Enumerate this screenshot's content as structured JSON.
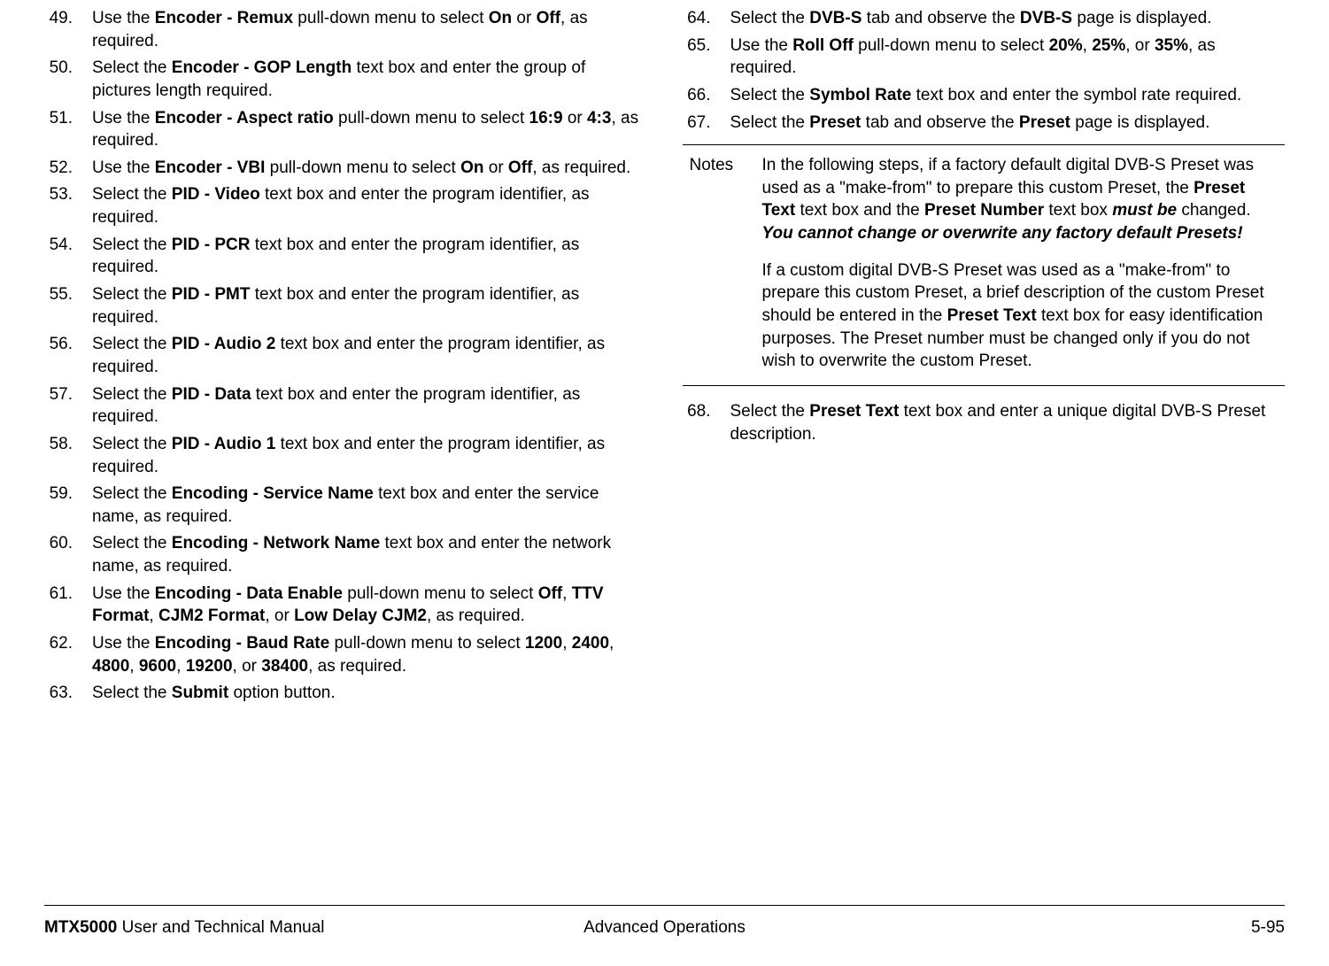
{
  "leftColumn": {
    "steps": [
      {
        "num": "49.",
        "parts": [
          "Use the ",
          {
            "b": "Encoder - Remux"
          },
          " pull-down menu to select ",
          {
            "b": "On"
          },
          " or ",
          {
            "b": "Off"
          },
          ", as required."
        ]
      },
      {
        "num": "50.",
        "parts": [
          "Select the ",
          {
            "b": "Encoder - GOP Length"
          },
          " text box and enter the group of pictures length required."
        ]
      },
      {
        "num": "51.",
        "parts": [
          "Use the ",
          {
            "b": "Encoder - Aspect ratio"
          },
          " pull-down menu to select ",
          {
            "b": "16:9"
          },
          " or ",
          {
            "b": "4:3"
          },
          ", as required."
        ]
      },
      {
        "num": "52.",
        "parts": [
          "Use the ",
          {
            "b": "Encoder - VBI"
          },
          " pull-down menu to select ",
          {
            "b": "On"
          },
          " or ",
          {
            "b": "Off"
          },
          ", as required."
        ]
      },
      {
        "num": "53.",
        "parts": [
          "Select the ",
          {
            "b": "PID - Video"
          },
          " text box and enter the program identifier, as required."
        ]
      },
      {
        "num": "54.",
        "parts": [
          "Select the ",
          {
            "b": "PID - PCR"
          },
          " text box and enter the program identifier, as required."
        ]
      },
      {
        "num": "55.",
        "parts": [
          "Select the ",
          {
            "b": "PID - PMT"
          },
          " text box and enter the program identifier, as required."
        ]
      },
      {
        "num": "56.",
        "parts": [
          "Select the ",
          {
            "b": "PID - Audio 2"
          },
          " text box and enter the program identifier, as required."
        ]
      },
      {
        "num": "57.",
        "parts": [
          "Select the ",
          {
            "b": "PID - Data"
          },
          " text box and enter the program identifier, as required."
        ]
      },
      {
        "num": "58.",
        "parts": [
          "Select the ",
          {
            "b": "PID - Audio 1"
          },
          " text box and enter the program identifier, as required."
        ]
      },
      {
        "num": "59.",
        "parts": [
          "Select the ",
          {
            "b": "Encoding - Service Name"
          },
          " text box and enter the service name, as required."
        ]
      },
      {
        "num": "60.",
        "parts": [
          "Select the ",
          {
            "b": "Encoding - Network Name"
          },
          " text box and enter the network name, as required."
        ]
      },
      {
        "num": "61.",
        "parts": [
          "Use the ",
          {
            "b": "Encoding - Data Enable"
          },
          " pull-down menu to select ",
          {
            "b": "Off"
          },
          ", ",
          {
            "b": "TTV Format"
          },
          ", ",
          {
            "b": "CJM2 Format"
          },
          ", or ",
          {
            "b": "Low Delay CJM2"
          },
          ", as required."
        ]
      },
      {
        "num": "62.",
        "parts": [
          "Use the ",
          {
            "b": "Encoding - Baud Rate"
          },
          " pull-down menu to select ",
          {
            "b": "1200"
          },
          ", ",
          {
            "b": "2400"
          },
          ", ",
          {
            "b": "4800"
          },
          ", ",
          {
            "b": "9600"
          },
          ", ",
          {
            "b": "19200"
          },
          ", or ",
          {
            "b": "38400"
          },
          ", as required."
        ]
      },
      {
        "num": "63.",
        "parts": [
          "Select the ",
          {
            "b": "Submit"
          },
          " option button."
        ]
      }
    ]
  },
  "rightColumn": {
    "stepsTop": [
      {
        "num": "64.",
        "parts": [
          "Select the ",
          {
            "b": "DVB-S"
          },
          " tab and observe the ",
          {
            "b": "DVB-S"
          },
          " page is displayed."
        ]
      },
      {
        "num": "65.",
        "parts": [
          "Use the ",
          {
            "b": "Roll Off"
          },
          " pull-down menu to select ",
          {
            "b": "20%"
          },
          ", ",
          {
            "b": "25%"
          },
          ", or ",
          {
            "b": "35%"
          },
          ", as required."
        ]
      },
      {
        "num": "66.",
        "parts": [
          "Select the ",
          {
            "b": "Symbol Rate"
          },
          " text box and enter the symbol rate required."
        ]
      },
      {
        "num": "67.",
        "parts": [
          "Select the ",
          {
            "b": "Preset"
          },
          " tab and observe the ",
          {
            "b": "Preset"
          },
          " page is displayed."
        ]
      }
    ],
    "notesLabel": "Notes",
    "notesParas": [
      [
        "In the following steps, if a factory default digital DVB-S Preset was used as a \"make-from\" to prepare this custom Preset, the ",
        {
          "b": "Preset Text"
        },
        " text box and the ",
        {
          "b": "Preset Number"
        },
        " text box ",
        {
          "bi": "must be"
        },
        " changed.  ",
        {
          "bi": "You cannot change or overwrite any factory default Presets!"
        }
      ],
      [
        "If a custom digital DVB-S Preset was used as a \"make-from\" to prepare this custom Preset, a brief description of the custom Preset should be entered in the ",
        {
          "b": "Preset Text"
        },
        " text box for easy identification purposes.  The Preset number must be changed only if you do not wish to overwrite the custom Preset."
      ]
    ],
    "stepsBottom": [
      {
        "num": "68.",
        "parts": [
          "Select the ",
          {
            "b": "Preset Text"
          },
          " text box and enter a unique digital DVB-S Preset description."
        ]
      }
    ]
  },
  "footer": {
    "product": "MTX5000",
    "leftRest": " User and Technical Manual",
    "center": "Advanced Operations",
    "right": "5-95"
  }
}
